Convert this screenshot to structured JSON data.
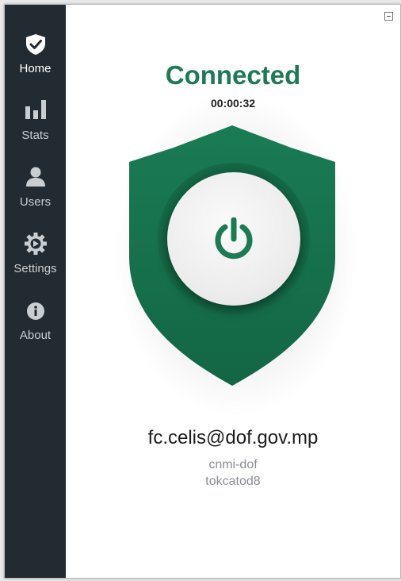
{
  "window": {
    "minimize_label": "minimize"
  },
  "sidebar": {
    "items": [
      {
        "label": "Home",
        "icon": "shield-check-icon",
        "active": true
      },
      {
        "label": "Stats",
        "icon": "bar-chart-icon",
        "active": false
      },
      {
        "label": "Users",
        "icon": "user-icon",
        "active": false
      },
      {
        "label": "Settings",
        "icon": "gear-icon",
        "active": false
      },
      {
        "label": "About",
        "icon": "info-icon",
        "active": false
      }
    ]
  },
  "status": {
    "title": "Connected",
    "timer": "00:00:32",
    "accent_color": "#1c7a55",
    "shield_color": "#18744f"
  },
  "power_button": {
    "icon": "power-icon"
  },
  "user": {
    "email": "fc.celis@dof.gov.mp",
    "line1": "cnmi-dof",
    "line2": "tokcatod8"
  }
}
